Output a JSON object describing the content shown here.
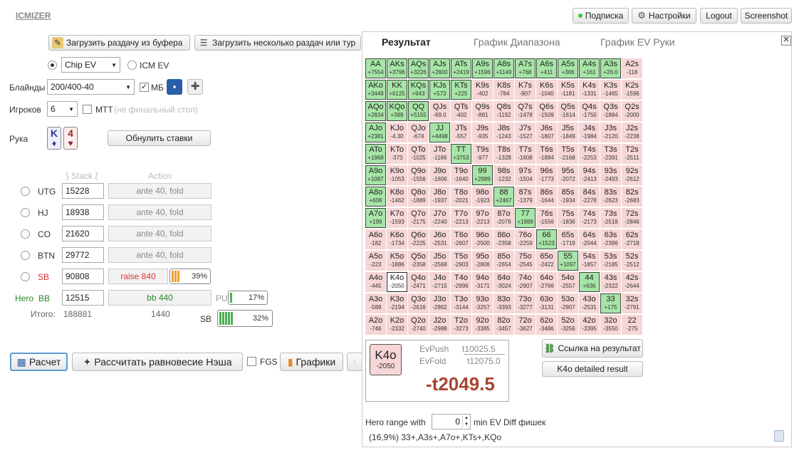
{
  "app": {
    "logo": "ICMIZER"
  },
  "topbar": {
    "subscription": "Подписка",
    "settings": "Настройки",
    "logout": "Logout",
    "screenshot": "Screenshot"
  },
  "load": {
    "from_clipboard": "Загрузить раздачу из буфера",
    "load_many": "Загрузить несколько раздач или тур"
  },
  "model": {
    "chip_ev": "Chip EV",
    "icm_ev": "ICM EV"
  },
  "blinds": {
    "label": "Блайнды",
    "value": "200/400-40",
    "mb": "МБ"
  },
  "players": {
    "label": "Игроков",
    "value": "6",
    "mtt": "МТТ",
    "mtt_note": "(не финальный стол)"
  },
  "hand": {
    "label": "Рука",
    "card1_rank": "K",
    "card1_suit": "♦",
    "card2_rank": "4",
    "card2_suit": "♥",
    "reset": "Обнулить ставки"
  },
  "table_headers": {
    "stack": "Stack",
    "action": "Action"
  },
  "seats": [
    {
      "pos": "UTG",
      "stack": "15228",
      "action": "ante 40, fold"
    },
    {
      "pos": "HJ",
      "stack": "18938",
      "action": "ante 40, fold"
    },
    {
      "pos": "CO",
      "stack": "21620",
      "action": "ante 40, fold"
    },
    {
      "pos": "BTN",
      "stack": "29772",
      "action": "ante 40, fold"
    },
    {
      "pos": "SB",
      "stack": "90808",
      "action": "raise 840",
      "pct": "39%"
    }
  ],
  "hero": {
    "hero_label": "Hero",
    "pos": "BB",
    "stack": "12515",
    "action": "bb 440",
    "pu_label": "PU",
    "pu_pct": "17%",
    "sb_label": "SB",
    "sb_pct": "32%"
  },
  "totals": {
    "label": "Итого:",
    "stack": "188881",
    "pot": "1440"
  },
  "bottom": {
    "calc": "Расчет",
    "nash": "Рассчитать равновесие Нэша",
    "fgs": "FGS",
    "charts": "Графики"
  },
  "tabs": {
    "result": "Результат",
    "range_chart": "График Диапазона",
    "ev_chart": "График EV Руки"
  },
  "grid": [
    [
      "AA",
      "+7554",
      1
    ],
    [
      "AKs",
      "+3796",
      1
    ],
    [
      "AQs",
      "+3226",
      1
    ],
    [
      "AJs",
      "+2800",
      1
    ],
    [
      "ATs",
      "+2419",
      1
    ],
    [
      "A9s",
      "+1596",
      1
    ],
    [
      "A8s",
      "+1149",
      1
    ],
    [
      "A7s",
      "+768",
      1
    ],
    [
      "A6s",
      "+411",
      1
    ],
    [
      "A5s",
      "+366",
      1
    ],
    [
      "A4s",
      "+161",
      1
    ],
    [
      "A3s",
      "+26.0",
      1
    ],
    [
      "A2s",
      "-118",
      0
    ],
    [
      "AKo",
      "+3449",
      1
    ],
    [
      "KK",
      "+6125",
      1
    ],
    [
      "KQs",
      "+943",
      1
    ],
    [
      "KJs",
      "+573",
      1
    ],
    [
      "KTs",
      "+225",
      1
    ],
    [
      "K9s",
      "-402",
      0
    ],
    [
      "K8s",
      "-784",
      0
    ],
    [
      "K7s",
      "-907",
      0
    ],
    [
      "K6s",
      "-1040",
      0
    ],
    [
      "K5s",
      "-1181",
      0
    ],
    [
      "K4s",
      "-1331",
      0
    ],
    [
      "K3s",
      "-1465",
      0
    ],
    [
      "K2s",
      "-1596",
      0
    ],
    [
      "AQo",
      "+2834",
      1
    ],
    [
      "KQo",
      "+389",
      1
    ],
    [
      "QQ",
      "+5155",
      1
    ],
    [
      "QJs",
      "-69.0",
      0
    ],
    [
      "QTs",
      "-402",
      0
    ],
    [
      "Q9s",
      "-881",
      0
    ],
    [
      "Q8s",
      "-1192",
      0
    ],
    [
      "Q7s",
      "-1478",
      0
    ],
    [
      "Q6s",
      "-1509",
      0
    ],
    [
      "Q5s",
      "-1614",
      0
    ],
    [
      "Q4s",
      "-1750",
      0
    ],
    [
      "Q3s",
      "-1884",
      0
    ],
    [
      "Q2s",
      "-2000",
      0
    ],
    [
      "AJo",
      "+2381",
      1
    ],
    [
      "KJo",
      "-4.30",
      0
    ],
    [
      "QJo",
      "-674",
      0
    ],
    [
      "JJ",
      "+4498",
      1
    ],
    [
      "JTs",
      "-557",
      0
    ],
    [
      "J9s",
      "-935",
      0
    ],
    [
      "J8s",
      "-1243",
      0
    ],
    [
      "J7s",
      "-1527",
      0
    ],
    [
      "J6s",
      "-1807",
      0
    ],
    [
      "J5s",
      "-1849",
      0
    ],
    [
      "J4s",
      "-1984",
      0
    ],
    [
      "J3s",
      "-2120",
      0
    ],
    [
      "J2s",
      "-2238",
      0
    ],
    [
      "ATo",
      "+1968",
      1
    ],
    [
      "KTo",
      "-373",
      0
    ],
    [
      "QTo",
      "-1025",
      0
    ],
    [
      "JTo",
      "-1186",
      0
    ],
    [
      "TT",
      "+3753",
      1
    ],
    [
      "T9s",
      "-977",
      0
    ],
    [
      "T8s",
      "-1328",
      0
    ],
    [
      "T7s",
      "-1608",
      0
    ],
    [
      "T6s",
      "-1884",
      0
    ],
    [
      "T5s",
      "-2168",
      0
    ],
    [
      "T4s",
      "-2253",
      0
    ],
    [
      "T3s",
      "-2391",
      0
    ],
    [
      "T2s",
      "-2511",
      0
    ],
    [
      "A9o",
      "+1087",
      1
    ],
    [
      "K9o",
      "-1053",
      0
    ],
    [
      "Q9o",
      "-1556",
      0
    ],
    [
      "J9o",
      "-1606",
      0
    ],
    [
      "T9o",
      "-1640",
      0
    ],
    [
      "99",
      "+2989",
      1
    ],
    [
      "98s",
      "-1232",
      0
    ],
    [
      "97s",
      "-1504",
      0
    ],
    [
      "96s",
      "-1773",
      0
    ],
    [
      "95s",
      "-2072",
      0
    ],
    [
      "94s",
      "-2413",
      0
    ],
    [
      "93s",
      "-2493",
      0
    ],
    [
      "92s",
      "-2612",
      0
    ],
    [
      "A8o",
      "+608",
      1
    ],
    [
      "K8o",
      "-1462",
      0
    ],
    [
      "Q8o",
      "-1889",
      0
    ],
    [
      "J8o",
      "-1937",
      0
    ],
    [
      "T8o",
      "-2021",
      0
    ],
    [
      "98o",
      "-1923",
      0
    ],
    [
      "88",
      "+2467",
      1
    ],
    [
      "87s",
      "-1379",
      0
    ],
    [
      "86s",
      "-1644",
      0
    ],
    [
      "85s",
      "-1934",
      0
    ],
    [
      "84s",
      "-2278",
      0
    ],
    [
      "83s",
      "-2623",
      0
    ],
    [
      "82s",
      "-2683",
      0
    ],
    [
      "A7o",
      "+199",
      1
    ],
    [
      "K7o",
      "-1593",
      0
    ],
    [
      "Q7o",
      "-2175",
      0
    ],
    [
      "J7o",
      "-2240",
      0
    ],
    [
      "T7o",
      "-2213",
      0
    ],
    [
      "97o",
      "-2213",
      0
    ],
    [
      "87o",
      "-2076",
      0
    ],
    [
      "77",
      "+1988",
      1
    ],
    [
      "76s",
      "-1556",
      0
    ],
    [
      "75s",
      "-1836",
      0
    ],
    [
      "74s",
      "-2173",
      0
    ],
    [
      "73s",
      "-2518",
      0
    ],
    [
      "72s",
      "-2846",
      0
    ],
    [
      "A6o",
      "-182",
      0
    ],
    [
      "K6o",
      "-1734",
      0
    ],
    [
      "Q6o",
      "-2225",
      0
    ],
    [
      "J6o",
      "-2531",
      0
    ],
    [
      "T6o",
      "-2607",
      0
    ],
    [
      "96o",
      "-2500",
      0
    ],
    [
      "86o",
      "-2358",
      0
    ],
    [
      "76o",
      "-2259",
      0
    ],
    [
      "66",
      "+1523",
      1
    ],
    [
      "65s",
      "-1719",
      0
    ],
    [
      "64s",
      "-2044",
      0
    ],
    [
      "63s",
      "-2386",
      0
    ],
    [
      "62s",
      "-2718",
      0
    ],
    [
      "A5o",
      "-223",
      0
    ],
    [
      "K5o",
      "-1886",
      0
    ],
    [
      "Q5o",
      "-2358",
      0
    ],
    [
      "J5o",
      "-2568",
      0
    ],
    [
      "T5o",
      "-2903",
      0
    ],
    [
      "95o",
      "-2806",
      0
    ],
    [
      "85o",
      "-2654",
      0
    ],
    [
      "75o",
      "-2545",
      0
    ],
    [
      "65o",
      "-2422",
      0
    ],
    [
      "55",
      "+1097",
      1
    ],
    [
      "54s",
      "-1857",
      0
    ],
    [
      "53s",
      "-2185",
      0
    ],
    [
      "52s",
      "-2512",
      0
    ],
    [
      "A4o",
      "-445",
      0
    ],
    [
      "K4o",
      "-2050",
      2
    ],
    [
      "Q4o",
      "-2471",
      0
    ],
    [
      "J4o",
      "-2715",
      0
    ],
    [
      "T4o",
      "-2996",
      0
    ],
    [
      "94o",
      "-3171",
      0
    ],
    [
      "84o",
      "-3024",
      0
    ],
    [
      "74o",
      "-2907",
      0
    ],
    [
      "64o",
      "-2766",
      0
    ],
    [
      "54o",
      "-2557",
      0
    ],
    [
      "44",
      "+636",
      1
    ],
    [
      "43s",
      "-2322",
      0
    ],
    [
      "42s",
      "-2644",
      0
    ],
    [
      "A3o",
      "-589",
      0
    ],
    [
      "K3o",
      "-2194",
      0
    ],
    [
      "Q3o",
      "-2616",
      0
    ],
    [
      "J3o",
      "-2862",
      0
    ],
    [
      "T3o",
      "-3144",
      0
    ],
    [
      "93o",
      "-3257",
      0
    ],
    [
      "83o",
      "-3393",
      0
    ],
    [
      "73o",
      "-3277",
      0
    ],
    [
      "63o",
      "-3131",
      0
    ],
    [
      "53o",
      "-2907",
      0
    ],
    [
      "43o",
      "-2531",
      0
    ],
    [
      "33",
      "+175",
      1
    ],
    [
      "32s",
      "-2791",
      0
    ],
    [
      "A2o",
      "-746",
      0
    ],
    [
      "K2o",
      "-2332",
      0
    ],
    [
      "Q2o",
      "-2740",
      0
    ],
    [
      "J2o",
      "-2988",
      0
    ],
    [
      "T2o",
      "-3273",
      0
    ],
    [
      "92o",
      "-3385",
      0
    ],
    [
      "82o",
      "-3457",
      0
    ],
    [
      "72o",
      "-3627",
      0
    ],
    [
      "62o",
      "-3486",
      0
    ],
    [
      "52o",
      "-3256",
      0
    ],
    [
      "42o",
      "-3395",
      0
    ],
    [
      "32o",
      "-3550",
      0
    ],
    [
      "22",
      "-275",
      0
    ]
  ],
  "selected": {
    "hand": "K4o",
    "ev": "-2050",
    "evpush_label": "EvPush",
    "evpush": "t10025.5",
    "evfold_label": "EvFold",
    "evfold": "t12075.0",
    "diff": "-t2049.5"
  },
  "links": {
    "result_link": "Ссылка на результат",
    "detailed": "K4o detailed result"
  },
  "range": {
    "prefix": "Hero range with",
    "value": "0",
    "suffix": "min EV Diff фишек",
    "summary": "(16,9%) 33+,A3s+,A7o+,KTs+,KQo"
  }
}
